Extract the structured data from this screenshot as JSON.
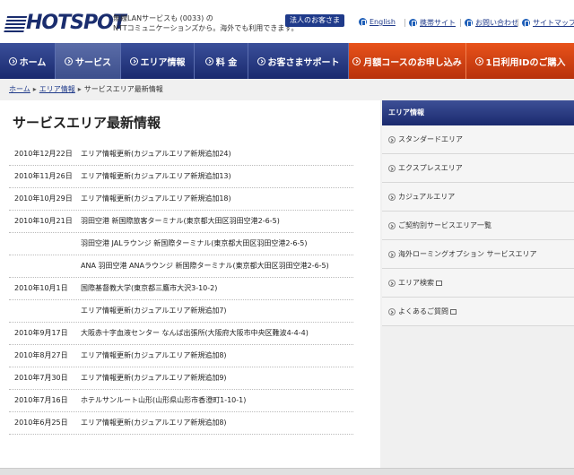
{
  "header": {
    "logo_text": "HOTSPOT",
    "tagline_line1": "無線LANサービスも (0033) の",
    "tagline_line2": "NTTコミュニケーションズから。海外でも利用できます。",
    "corp_button": "法人のお客さま",
    "links": [
      "English",
      "携帯サイト",
      "お問い合わせ",
      "サイトマップ"
    ]
  },
  "nav": {
    "items": [
      "ホーム",
      "サービス",
      "エリア情報",
      "料 金",
      "お客さまサポート"
    ],
    "orange_items": [
      "月額コースのお申し込み",
      "1日利用IDのご購入"
    ]
  },
  "breadcrumb": {
    "home": "ホーム",
    "area": "エリア情報",
    "current": "サービスエリア最新情報"
  },
  "main": {
    "title": "サービスエリア最新情報",
    "news": [
      {
        "date": "2010年12月22日",
        "text": "エリア情報更新(カジュアルエリア新規追加24)"
      },
      {
        "date": "2010年11月26日",
        "text": "エリア情報更新(カジュアルエリア新規追加13)"
      },
      {
        "date": "2010年10月29日",
        "text": "エリア情報更新(カジュアルエリア新規追加18)"
      },
      {
        "date": "2010年10月21日",
        "text": "羽田空港 新国際旅客ターミナル(東京都大田区羽田空港2-6-5)"
      },
      {
        "date": "",
        "text": "羽田空港 JALラウンジ 新国際ターミナル(東京都大田区羽田空港2-6-5)"
      },
      {
        "date": "",
        "text": "ANA 羽田空港 ANAラウンジ 新国際ターミナル(東京都大田区羽田空港2-6-5)"
      },
      {
        "date": "2010年10月1日",
        "text": "国際基督教大学(東京都三鷹市大沢3-10-2)"
      },
      {
        "date": "",
        "text": "エリア情報更新(カジュアルエリア新規追加7)"
      },
      {
        "date": "2010年9月17日",
        "text": "大阪赤十字血液センター なんば出張所(大阪府大阪市中央区難波4-4-4)"
      },
      {
        "date": "2010年8月27日",
        "text": "エリア情報更新(カジュアルエリア新規追加8)"
      },
      {
        "date": "2010年7月30日",
        "text": "エリア情報更新(カジュアルエリア新規追加9)"
      },
      {
        "date": "2010年7月16日",
        "text": "ホテルサンルート山形(山形県山形市香澄町1-10-1)"
      },
      {
        "date": "2010年6月25日",
        "text": "エリア情報更新(カジュアルエリア新規追加8)"
      }
    ]
  },
  "sidebar": {
    "title": "エリア情報",
    "items": [
      "スタンダードエリア",
      "エクスプレスエリア",
      "カジュアルエリア",
      "ご契約別サービスエリア一覧",
      "海外ローミングオプション サービスエリア",
      "エリア検索",
      "よくあるご質問"
    ]
  },
  "colors": {
    "nav_blue": "#1a2a6e",
    "nav_orange": "#d0400f",
    "link": "#1f3a8a"
  }
}
